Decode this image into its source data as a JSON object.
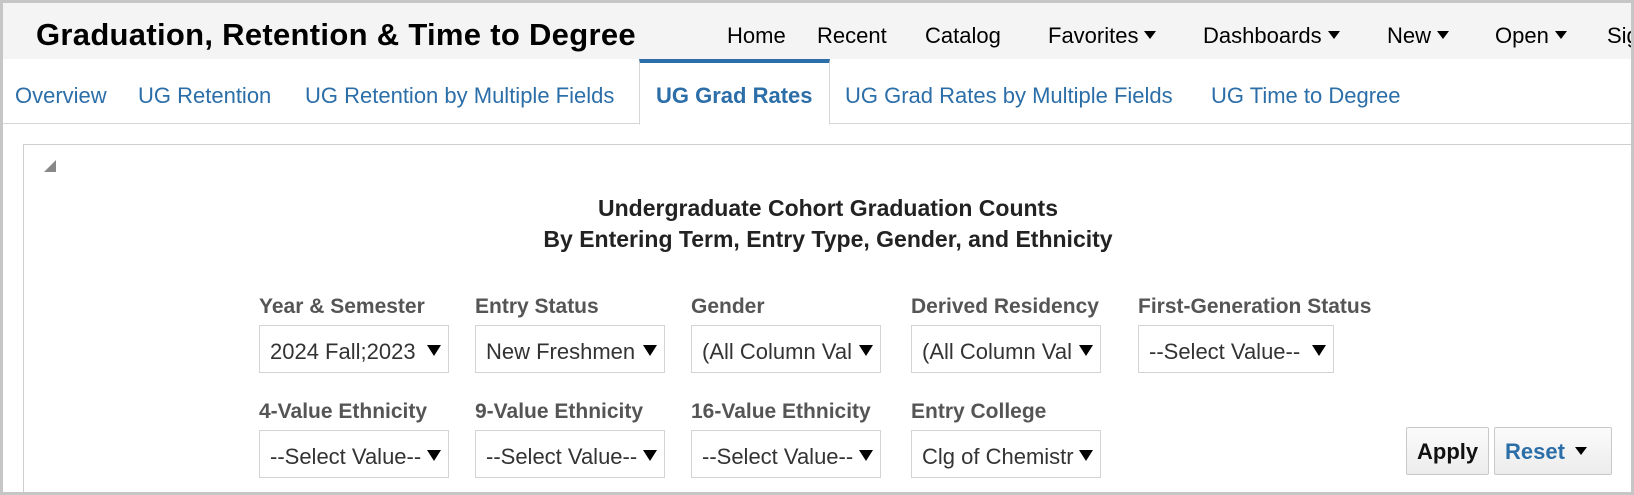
{
  "header": {
    "app_title": "Graduation, Retention & Time to Degree",
    "nav": [
      {
        "label": "Home"
      },
      {
        "label": "Recent"
      },
      {
        "label": "Catalog"
      },
      {
        "label": "Favorites"
      },
      {
        "label": "Dashboards"
      },
      {
        "label": "New"
      },
      {
        "label": "Open"
      },
      {
        "label": "Sig"
      }
    ]
  },
  "tabs": [
    {
      "label": "Overview"
    },
    {
      "label": "UG Retention"
    },
    {
      "label": "UG Retention by Multiple Fields"
    },
    {
      "label": "UG Grad Rates"
    },
    {
      "label": "UG Grad Rates by Multiple Fields"
    },
    {
      "label": "UG Time to Degree"
    }
  ],
  "report": {
    "title_line1": "Undergraduate Cohort Graduation Counts",
    "title_line2": "By Entering Term, Entry Type, Gender, and Ethnicity"
  },
  "prompts": {
    "year_semester": {
      "label": "Year & Semester",
      "value": "2024 Fall;2023"
    },
    "entry_status": {
      "label": "Entry Status",
      "value": "New Freshmen"
    },
    "gender": {
      "label": "Gender",
      "value": "(All Column Val"
    },
    "derived_residency": {
      "label": "Derived Residency",
      "value": "(All Column Val"
    },
    "first_gen": {
      "label": "First-Generation Status",
      "value": "--Select Value--"
    },
    "eth4": {
      "label": "4-Value Ethnicity",
      "value": "--Select Value--"
    },
    "eth9": {
      "label": "9-Value Ethnicity",
      "value": "--Select Value--"
    },
    "eth16": {
      "label": "16-Value Ethnicity",
      "value": "--Select Value--"
    },
    "entry_college": {
      "label": "Entry College",
      "value": "Clg of Chemistr"
    }
  },
  "buttons": {
    "apply": "Apply",
    "reset": "Reset"
  },
  "colors": {
    "link_blue": "#2c6ea8",
    "header_bg": "#f4f4f4"
  }
}
